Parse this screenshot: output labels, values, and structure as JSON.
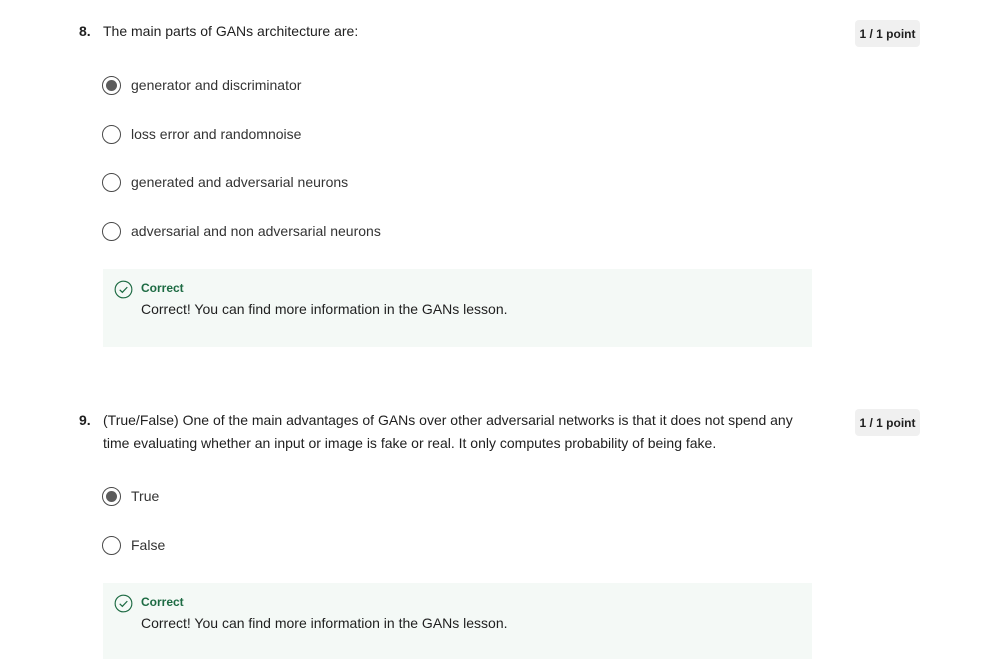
{
  "colors": {
    "correct_green": "#1d6b43",
    "feedback_bg": "#f4f9f6",
    "badge_bg": "#f0f0f0"
  },
  "questions": [
    {
      "number": "8.",
      "text": "The main parts of GANs architecture are:",
      "points": "1 / 1 point",
      "options": [
        {
          "label": "generator and discriminator",
          "selected": true
        },
        {
          "label": "loss error and randomnoise",
          "selected": false
        },
        {
          "label": "generated and adversarial neurons",
          "selected": false
        },
        {
          "label": "adversarial and non adversarial neurons",
          "selected": false
        }
      ],
      "feedback": {
        "icon": "check-circle-icon",
        "title": "Correct",
        "message": "Correct! You can find more information in the GANs lesson."
      }
    },
    {
      "number": "9.",
      "text": "(True/False) One of the main advantages of GANs over other adversarial networks is that it does not spend any time evaluating whether an input or image is fake or real. It only computes probability of being fake.",
      "points": "1 / 1 point",
      "options": [
        {
          "label": "True",
          "selected": true
        },
        {
          "label": "False",
          "selected": false
        }
      ],
      "feedback": {
        "icon": "check-circle-icon",
        "title": "Correct",
        "message": "Correct! You can find more information in the GANs lesson."
      }
    }
  ]
}
